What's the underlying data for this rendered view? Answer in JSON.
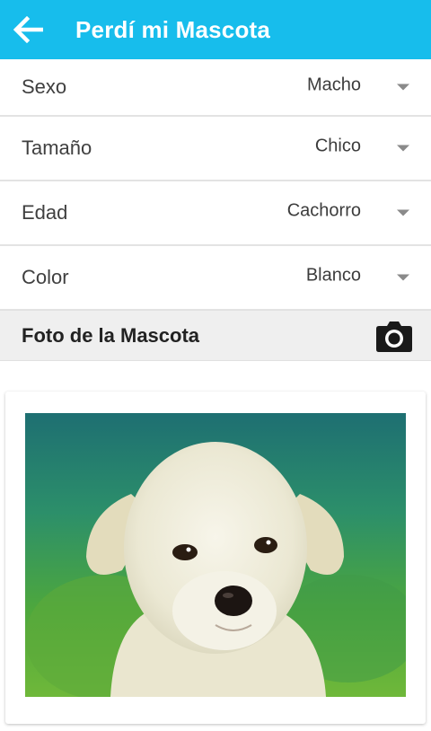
{
  "header": {
    "title": "Perdí mi Mascota",
    "back_icon": "arrow-left-icon"
  },
  "form": {
    "fields": [
      {
        "label": "Sexo",
        "value": "Macho"
      },
      {
        "label": "Tamaño",
        "value": "Chico"
      },
      {
        "label": "Edad",
        "value": "Cachorro"
      },
      {
        "label": "Color",
        "value": "Blanco"
      }
    ]
  },
  "photo_section": {
    "label": "Foto de la Mascota",
    "camera_icon": "camera-icon"
  },
  "colors": {
    "app_bar": "#17bdec",
    "section_bg": "#efefef"
  }
}
